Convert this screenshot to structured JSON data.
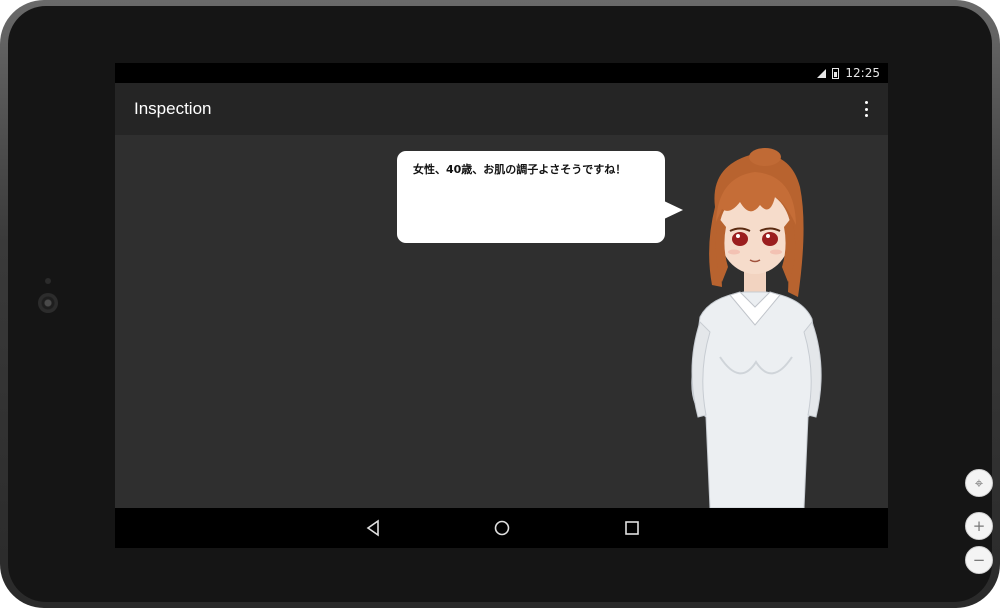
{
  "status_bar": {
    "time": "12:25",
    "icons": [
      "signal-icon",
      "battery-icon"
    ]
  },
  "app_bar": {
    "title": "Inspection",
    "menu_icon": "overflow-menu-icon"
  },
  "dialogue": {
    "text": "女性、40歳、お肌の調子よさそうですね！"
  },
  "character": {
    "description_icon": "nurse-character-illustration"
  },
  "nav_bar": {
    "buttons": [
      "back-icon",
      "home-icon",
      "recents-icon"
    ]
  },
  "emulator_controls": {
    "fit_symbol": "⌖",
    "zoom_in_symbol": "+",
    "zoom_out_symbol": "−"
  },
  "colors": {
    "screen_bg": "#2f2f2f",
    "app_bar_bg": "#252525",
    "status_bar_bg": "#000000",
    "nav_bar_bg": "#000000",
    "bubble_bg": "#ffffff"
  }
}
